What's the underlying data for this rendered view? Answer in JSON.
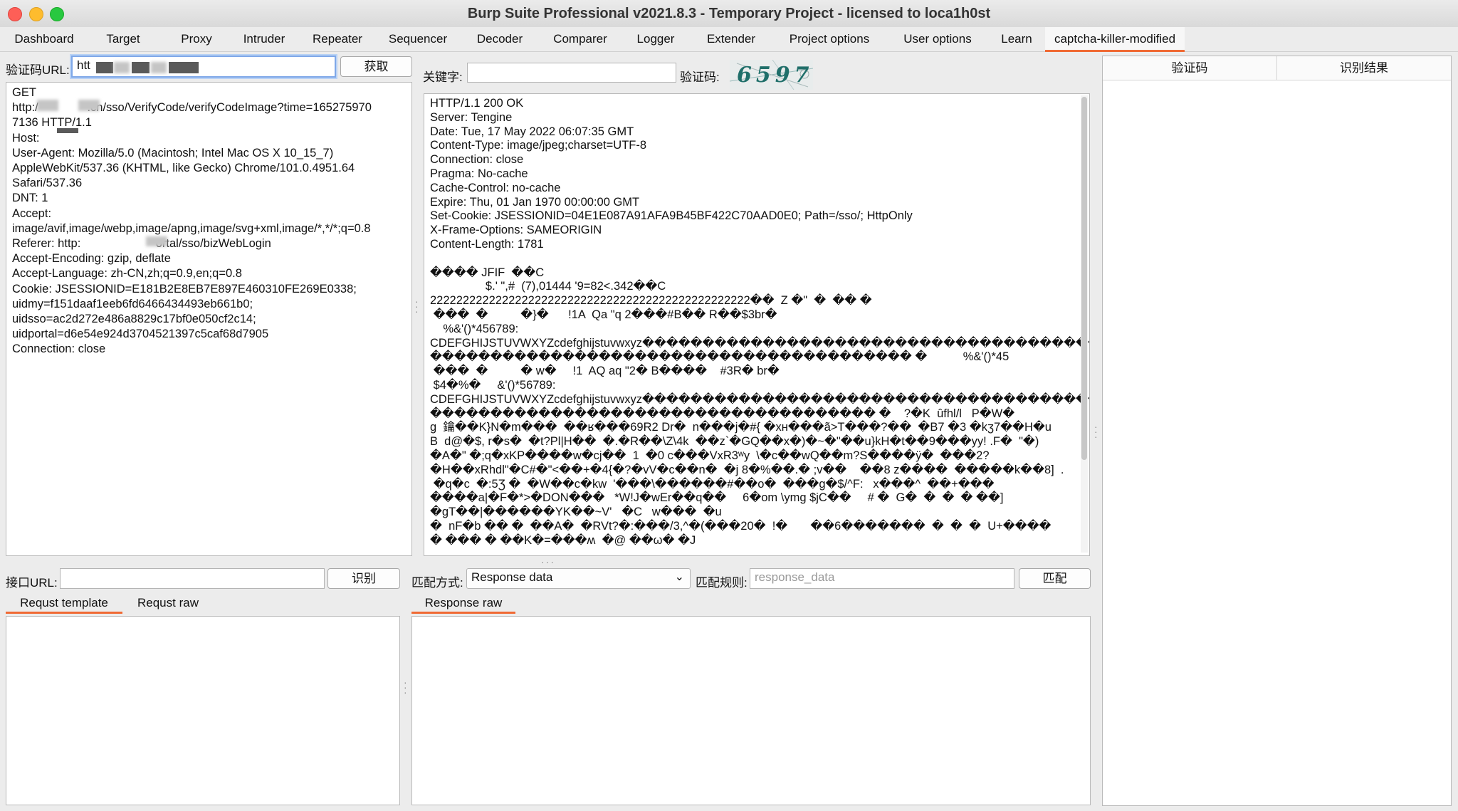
{
  "window": {
    "title": "Burp Suite Professional v2021.8.3 - Temporary Project - licensed to loca1h0st"
  },
  "tabs": [
    "Dashboard",
    "Target",
    "Proxy",
    "Intruder",
    "Repeater",
    "Sequencer",
    "Decoder",
    "Comparer",
    "Logger",
    "Extender",
    "Project options",
    "User options",
    "Learn",
    "captcha-killer-modified"
  ],
  "active_tab": "captcha-killer-modified",
  "left_top": {
    "url_label": "验证码URL:",
    "url_value": "htt",
    "fetch_button": "获取",
    "request_lines": [
      "GET",
      "http:/               .cn/sso/VerifyCode/verifyCodeImage?time=165275970",
      "7136 HTTP/1.1",
      "Host:",
      "User-Agent: Mozilla/5.0 (Macintosh; Intel Mac OS X 10_15_7)",
      "AppleWebKit/537.36 (KHTML, like Gecko) Chrome/101.0.4951.64",
      "Safari/537.36",
      "DNT: 1",
      "Accept:",
      "image/avif,image/webp,image/apng,image/svg+xml,image/*,*/*;q=0.8",
      "Referer: http:                       ortal/sso/bizWebLogin",
      "Accept-Encoding: gzip, deflate",
      "Accept-Language: zh-CN,zh;q=0.9,en;q=0.8",
      "Cookie: JSESSIONID=E181B2E8EB7E897E460310FE269E0338;",
      "uidmy=f151daaf1eeb6fd6466434493eb661b0;",
      "uidsso=ac2d272e486a8829c17bf0e050cf2c14;",
      "uidportal=d6e54e924d3704521397c5caf68d7905",
      "Connection: close"
    ]
  },
  "middle_top": {
    "keyword_label": "关键字:",
    "keyword_value": "",
    "captcha_label": "验证码:",
    "captcha_digits": "6597",
    "response_lines": [
      "HTTP/1.1 200 OK",
      "Server: Tengine",
      "Date: Tue, 17 May 2022 06:07:35 GMT",
      "Content-Type: image/jpeg;charset=UTF-8",
      "Connection: close",
      "Pragma: No-cache",
      "Cache-Control: no-cache",
      "Expire: Thu, 01 Jan 1970 00:00:00 GMT",
      "Set-Cookie: JSESSIONID=04E1E087A91AFA9B45BF422C70AAD0E0; Path=/sso/; HttpOnly",
      "X-Frame-Options: SAMEORIGIN",
      "Content-Length: 1781",
      "",
      "���� JFIF  ��C",
      "                 $.' \",#  (7),01444 '9=82<.342��C",
      "2222222222222222222222222222222222222222222222222��  Z �\"  �  �� �",
      " ���  �          �}�      !1A  Qa \"q 2���#B�� R��$3br�",
      "    %&'()*456789:",
      "CDEFGHIJSTUVWXYZcdefghijstuvwxyz������������������������������������������",
      "���������������������������������������� �           %&'()*45",
      " ���  �          � w�     !1  AQ aq \"2� B����    #3R� br�",
      " $4�%�     &'()*56789:",
      "CDEFGHIJSTUVWXYZcdefghijstuvwxyz������������������������������������������",
      "������������������������������������� �    ?�K  ûfhl/l   P�W�",
      "g  鑰��K}N�m���  ��ʁ���69R2 Dr�  n���j�#{ �xʜ���ã>T���?��  �B7 �3 �kʒ7��H�u",
      "B  d@�$, r�s�  �t?Pl|H��  �.�R��\\Z\\4k  ��z`�GQ��x�)�~�\"��u}kH�t��9���yy! .F�  \"�)",
      "�A�\" �;q�xKP����w�cj��  1  �0 c���VxR3ʷy  \\�c��wQ��m?S����ÿ�  ���2?",
      "�H��xRhdl\"�C#�\"<��+�4{�?�vV�c��n�  �j 8�%��.� ;v��    ��8 z����  �����k��8]  .",
      " �q�c  �:5Ʒ �  �W��c�kw  '���\\������#��o�  ���g�$/^F:   x���^  ��+���",
      "����a|�F�*>�DON���   *W!J�wEr��q��     6�om \\ymg $jC��     # �  G�  �  �  � ��]",
      "�gT��|������YK��~V'   �C   w���  �u",
      "�  nF�b �� �  ��A�  �RVt?�:���/3,^�(���20�  !�       ��6�������  �  �  �  U+����",
      "� ��� � ��K�=���ʍ  �@ ��ω� �J"
    ]
  },
  "right_table": {
    "columns": [
      "验证码",
      "识别结果"
    ]
  },
  "bottom_left": {
    "interface_label": "接口URL:",
    "interface_value": "",
    "recognize_button": "识别",
    "subtabs": [
      "Requst template",
      "Requst raw"
    ],
    "active_subtab": "Requst template"
  },
  "bottom_middle": {
    "match_mode_label": "匹配方式:",
    "match_mode_value": "Response data",
    "match_rule_label": "匹配规则:",
    "match_rule_placeholder": "response_data",
    "match_button": "匹配",
    "subtabs": [
      "Response raw"
    ],
    "active_subtab": "Response raw"
  },
  "colors": {
    "accent_orange": "#f06a34",
    "captcha_teal": "#1f6f6a",
    "captcha_bg": "#e8ecec"
  }
}
